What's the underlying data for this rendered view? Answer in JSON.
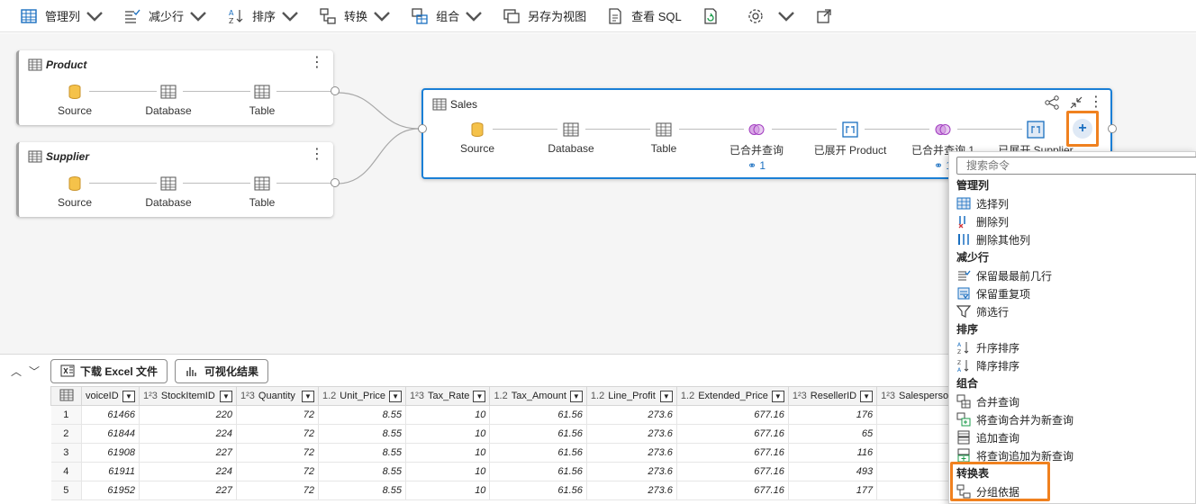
{
  "toolbar": {
    "manage_columns": "管理列",
    "reduce_rows": "减少行",
    "sort": "排序",
    "transform": "转换",
    "combine": "组合",
    "save_as_view": "另存为视图",
    "view_sql": "查看 SQL"
  },
  "queries": {
    "product": {
      "title": "Product",
      "steps": [
        "Source",
        "Database",
        "Table"
      ]
    },
    "supplier": {
      "title": "Supplier",
      "steps": [
        "Source",
        "Database",
        "Table"
      ]
    },
    "sales": {
      "title": "Sales",
      "steps": [
        "Source",
        "Database",
        "Table",
        "已合并查询",
        "已展开 Product",
        "已合并查询 1",
        "已展开 Supplier"
      ],
      "step_link_counts": [
        "1",
        "1"
      ]
    }
  },
  "bottom": {
    "download_excel": "下载 Excel 文件",
    "visualize": "可视化结果"
  },
  "table": {
    "columns": [
      {
        "type": "",
        "name": "voiceID"
      },
      {
        "type": "1²3",
        "name": "StockItemID"
      },
      {
        "type": "1²3",
        "name": "Quantity"
      },
      {
        "type": "1.2",
        "name": "Unit_Price"
      },
      {
        "type": "1²3",
        "name": "Tax_Rate"
      },
      {
        "type": "1.2",
        "name": "Tax_Amount"
      },
      {
        "type": "1.2",
        "name": "Line_Profit"
      },
      {
        "type": "1.2",
        "name": "Extended_Price"
      },
      {
        "type": "1²3",
        "name": "ResellerID"
      },
      {
        "type": "1²3",
        "name": "SalespersonPer"
      }
    ],
    "rows": [
      {
        "n": "1",
        "c": [
          "61466",
          "220",
          "72",
          "8.55",
          "10",
          "61.56",
          "273.6",
          "677.16",
          "176"
        ]
      },
      {
        "n": "2",
        "c": [
          "61844",
          "224",
          "72",
          "8.55",
          "10",
          "61.56",
          "273.6",
          "677.16",
          "65"
        ]
      },
      {
        "n": "3",
        "c": [
          "61908",
          "227",
          "72",
          "8.55",
          "10",
          "61.56",
          "273.6",
          "677.16",
          "116"
        ]
      },
      {
        "n": "4",
        "c": [
          "61911",
          "224",
          "72",
          "8.55",
          "10",
          "61.56",
          "273.6",
          "677.16",
          "493"
        ]
      },
      {
        "n": "5",
        "c": [
          "61952",
          "227",
          "72",
          "8.55",
          "10",
          "61.56",
          "273.6",
          "677.16",
          "177"
        ]
      }
    ]
  },
  "menu": {
    "search_placeholder": "搜索命令",
    "sections": [
      {
        "header": "管理列",
        "items": [
          {
            "label": "选择列",
            "icon": "choose-columns-icon"
          },
          {
            "label": "删除列",
            "icon": "remove-columns-icon"
          },
          {
            "label": "删除其他列",
            "icon": "remove-other-columns-icon"
          }
        ]
      },
      {
        "header": "减少行",
        "items": [
          {
            "label": "保留最最前几行",
            "icon": "keep-top-rows-icon"
          },
          {
            "label": "保留重复项",
            "icon": "keep-duplicates-icon"
          },
          {
            "label": "筛选行",
            "icon": "filter-icon"
          }
        ]
      },
      {
        "header": "排序",
        "items": [
          {
            "label": "升序排序",
            "icon": "sort-ascending-icon"
          },
          {
            "label": "降序排序",
            "icon": "sort-descending-icon"
          }
        ]
      },
      {
        "header": "组合",
        "items": [
          {
            "label": "合并查询",
            "icon": "merge-queries-icon"
          },
          {
            "label": "将查询合并为新查询",
            "icon": "merge-new-icon"
          },
          {
            "label": "追加查询",
            "icon": "append-queries-icon"
          },
          {
            "label": "将查询追加为新查询",
            "icon": "append-new-icon"
          }
        ]
      },
      {
        "header": "转换表",
        "items": [
          {
            "label": "分组依据",
            "icon": "group-by-icon"
          }
        ]
      }
    ]
  },
  "colors": {
    "accent": "#1a7fd6",
    "highlight": "#f0811f",
    "merge": "#a23ec0"
  }
}
